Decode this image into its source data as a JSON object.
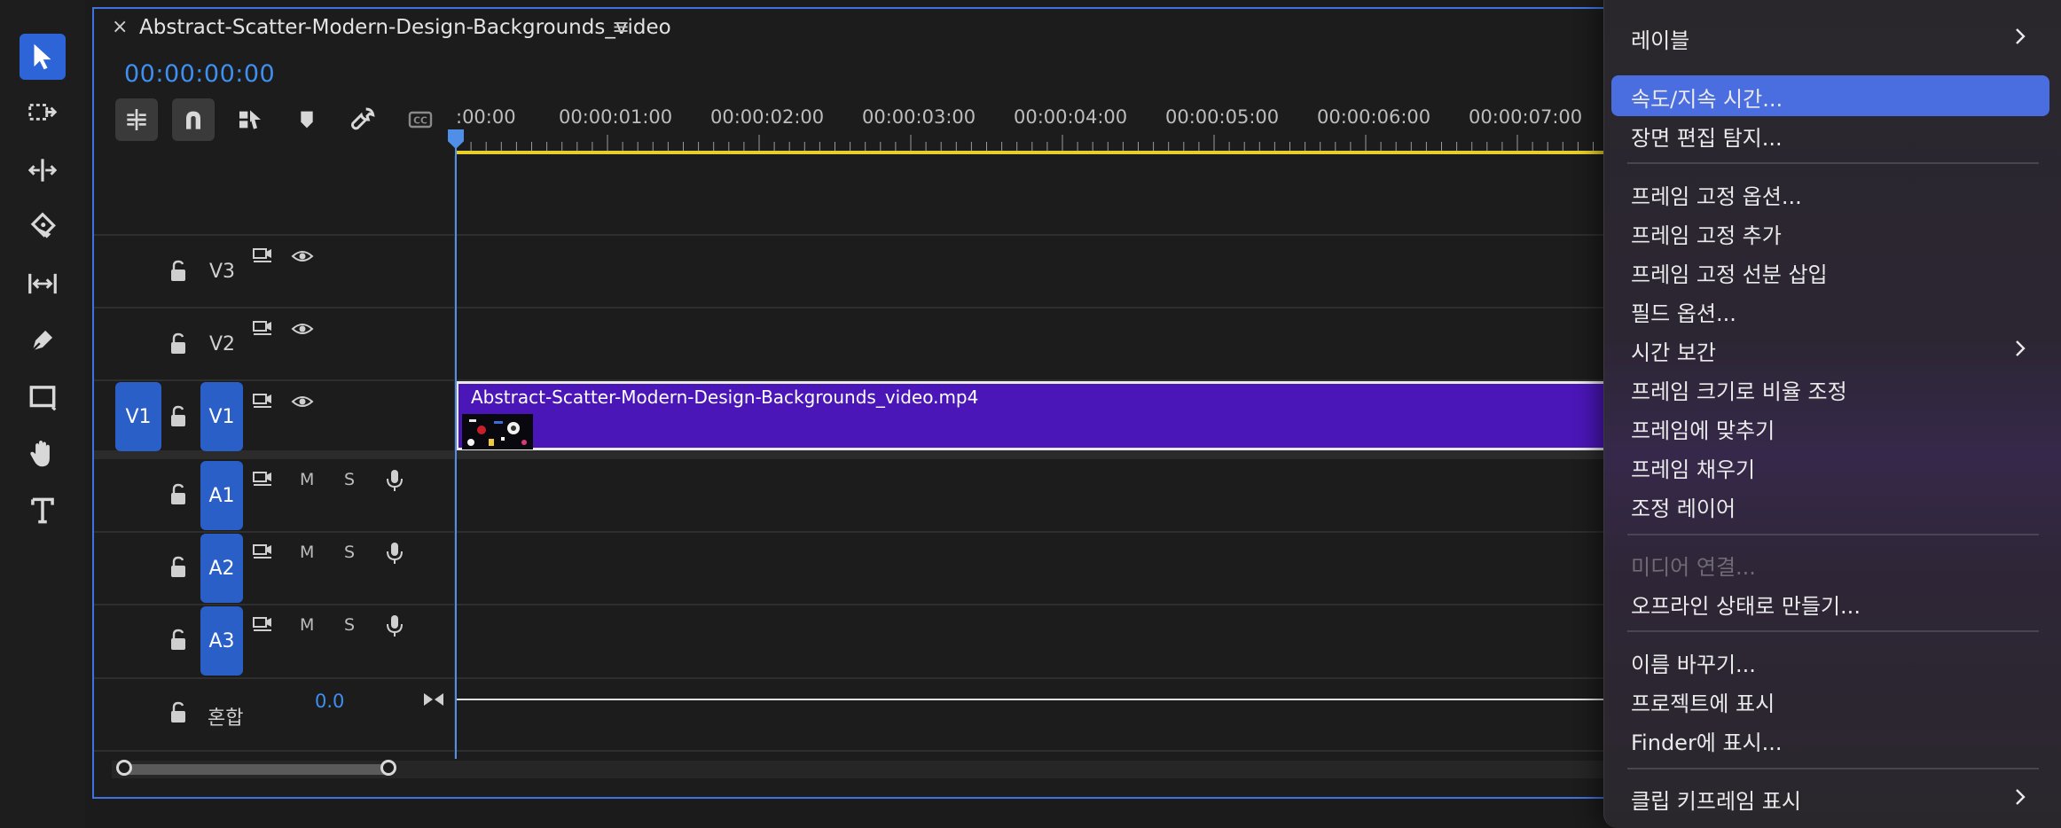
{
  "sequence": {
    "title": "Abstract-Scatter-Modern-Design-Backgrounds_video",
    "timecode": "00:00:00:00",
    "close_glyph": "×",
    "menu_glyph": "≡"
  },
  "tools": [
    "selection-tool-icon",
    "track-select-tool-icon",
    "ripple-edit-tool-icon",
    "razor-tool-icon",
    "slip-tool-icon",
    "pen-tool-icon",
    "rectangle-tool-icon",
    "hand-tool-icon",
    "type-tool-icon"
  ],
  "timeline_buttons": [
    "nest-sequence-icon",
    "snap-icon",
    "linked-selection-icon",
    "add-marker-icon",
    "settings-wrench-icon",
    "captions-icon"
  ],
  "ruler": {
    "labels": [
      ":00:00",
      "00:00:01:00",
      "00:00:02:00",
      "00:00:03:00",
      "00:00:04:00",
      "00:00:05:00",
      "00:00:06:00",
      "00:00:07:00"
    ]
  },
  "tracks": {
    "v3": "V3",
    "v2": "V2",
    "v1": "V1",
    "v1_source": "V1",
    "a1": "A1",
    "a2": "A2",
    "a3": "A3",
    "mute": "M",
    "solo": "S",
    "mix_label": "혼합",
    "mix_value": "0.0"
  },
  "clip": {
    "name": "Abstract-Scatter-Modern-Design-Backgrounds_video.mp4"
  },
  "menu": {
    "items": {
      "label": "레이블",
      "speed": "속도/지속 시간...",
      "scene_detect": "장면 편집 탐지...",
      "frame_hold_options": "프레임 고정 옵션...",
      "add_frame_hold": "프레임 고정 추가",
      "insert_frame_hold": "프레임 고정 선분 삽입",
      "field_options": "필드 옵션...",
      "time_interp": "시간 보간",
      "scale_to_frame": "프레임 크기로 비율 조정",
      "fit_frame": "프레임에 맞추기",
      "fill_frame": "프레임 채우기",
      "adjustment_layer": "조정 레이어",
      "link_media": "미디어 연결...",
      "make_offline": "오프라인 상태로 만들기...",
      "rename": "이름 바꾸기...",
      "reveal_project": "프로젝트에 표시",
      "reveal_finder": "Finder에 표시...",
      "show_keyframes": "클립 키프레임 표시"
    }
  },
  "colors": {
    "accent": "#2d64d8",
    "clip": "#4a16b8",
    "timecode": "#3f8ff0",
    "work_area": "#e6cf2a",
    "menu_highlight": "#4a6ee0"
  }
}
